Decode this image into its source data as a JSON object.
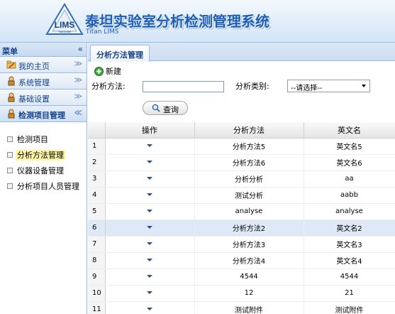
{
  "header": {
    "logo_text": "LIMS",
    "logo_sub": "Titanovate",
    "title": "泰坦实验室分析检测管理系统",
    "subtitle": "Titan LIMS"
  },
  "sidebar": {
    "title": "菜单",
    "collapse_glyph": "«",
    "sections": [
      {
        "label": "我的主页",
        "icon": "home-folder-icon",
        "toggle": "≫"
      },
      {
        "label": "系统管理",
        "icon": "user-admin-icon",
        "toggle": "≫"
      },
      {
        "label": "基础设置",
        "icon": "user-admin-icon",
        "toggle": "≫"
      },
      {
        "label": "检测项目管理",
        "icon": "user-admin-icon",
        "toggle": "≪"
      }
    ],
    "tree": [
      {
        "label": "检测项目"
      },
      {
        "label": "分析方法管理"
      },
      {
        "label": "仪器设备管理"
      },
      {
        "label": "分析项目人员管理"
      }
    ]
  },
  "main": {
    "tab": "分析方法管理",
    "toolbar": {
      "new_label": "新建",
      "method_label": "分析方法:",
      "method_value": "",
      "category_label": "分析类别:",
      "category_selected": "--请选择--",
      "query_label": "查询"
    },
    "grid": {
      "columns": [
        "",
        "操作",
        "分析方法",
        "英文名"
      ],
      "rows": [
        {
          "n": "1",
          "method": "分析方法5",
          "english": "英文名5"
        },
        {
          "n": "2",
          "method": "分析方法6",
          "english": "英文名6"
        },
        {
          "n": "3",
          "method": "分析分析",
          "english": "aa"
        },
        {
          "n": "4",
          "method": "测试分析",
          "english": "aabb"
        },
        {
          "n": "5",
          "method": "analyse",
          "english": "analyse"
        },
        {
          "n": "6",
          "method": "分析方法2",
          "english": "英文名2"
        },
        {
          "n": "7",
          "method": "分析方法3",
          "english": "英文名3"
        },
        {
          "n": "8",
          "method": "分析方法4",
          "english": "英文名4"
        },
        {
          "n": "9",
          "method": "4544",
          "english": "4544"
        },
        {
          "n": "10",
          "method": "12",
          "english": "21"
        },
        {
          "n": "11",
          "method": "测试附件",
          "english": "测试附件"
        }
      ]
    }
  },
  "colors": {
    "accent": "#15428b",
    "border": "#99bbe8",
    "title_blue": "#1e5fb5",
    "selected_row": "#dfe8f6",
    "selected_tree": "#fdf4a6"
  }
}
